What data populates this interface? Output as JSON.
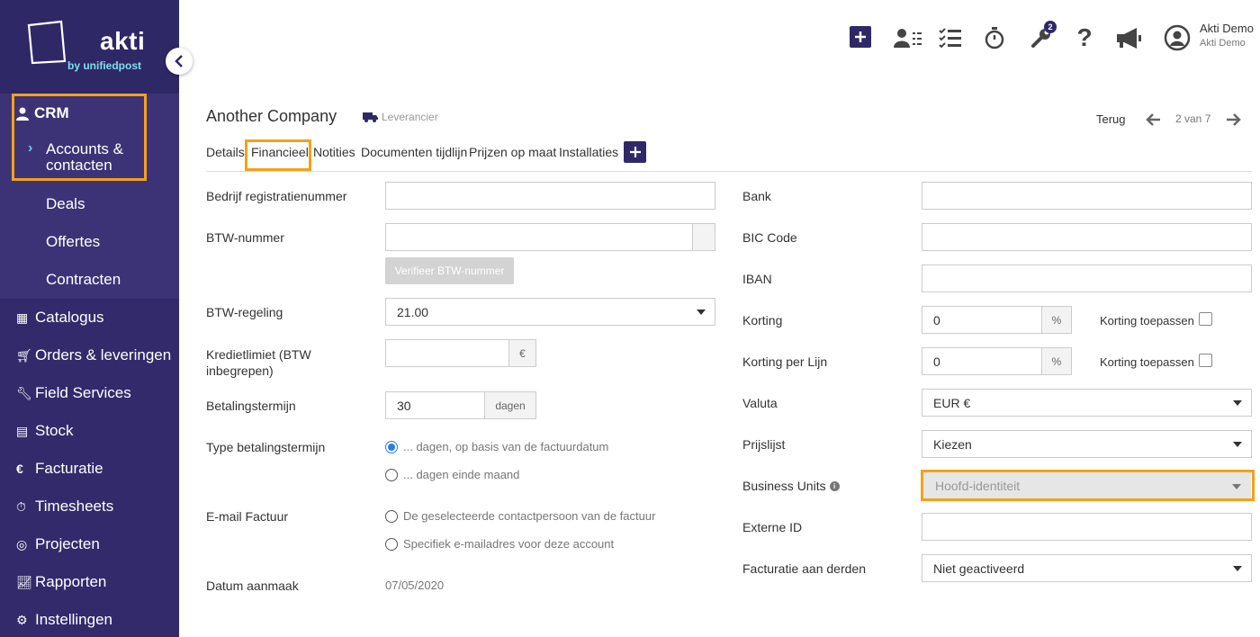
{
  "brand": {
    "name": "akti",
    "tagline": "by unifiedpost"
  },
  "sidebar": {
    "crm": "CRM",
    "crm_items": [
      "Accounts & contacten",
      "Deals",
      "Offertes",
      "Contracten"
    ],
    "main_items": [
      {
        "label": "Catalogus",
        "icon": "book-icon"
      },
      {
        "label": "Orders & leveringen",
        "icon": "cart-icon"
      },
      {
        "label": "Field Services",
        "icon": "wrench-icon"
      },
      {
        "label": "Stock",
        "icon": "boxes-icon"
      },
      {
        "label": "Facturatie",
        "icon": "euro-icon"
      },
      {
        "label": "Timesheets",
        "icon": "stopwatch-icon"
      },
      {
        "label": "Projecten",
        "icon": "target-icon"
      },
      {
        "label": "Rapporten",
        "icon": "chart-icon"
      },
      {
        "label": "Instellingen",
        "icon": "gear-icon"
      }
    ]
  },
  "topbar": {
    "badge_count": "2",
    "user_name": "Akti Demo",
    "user_company": "Akti Demo"
  },
  "header": {
    "title": "Another Company",
    "type_label": "Leverancier",
    "back": "Terug",
    "pager": "2 van 7"
  },
  "tabs": [
    "Details",
    "Financieel",
    "Notities",
    "Documenten tijdlijn",
    "Prijzen op maat",
    "Installaties"
  ],
  "left": {
    "reg_label": "Bedrijf registratienummer",
    "reg_value": "",
    "vat_label": "BTW-nummer",
    "vat_value": "",
    "verify_btn": "Verifieer BTW-nummer",
    "vat_regime_label": "BTW-regeling",
    "vat_regime_value": "21.00",
    "credit_label_1": "Kredietlimiet (BTW",
    "credit_label_2": "inbegrepen)",
    "credit_value": "",
    "credit_unit": "€",
    "term_label": "Betalingstermijn",
    "term_value": "30",
    "term_unit": "dagen",
    "term_type_label": "Type betalingstermijn",
    "term_type_options": [
      "... dagen, op basis van de factuurdatum",
      "... dagen einde maand"
    ],
    "email_label": "E-mail Factuur",
    "email_options": [
      "De geselecteerde contactpersoon van de factuur",
      "Specifiek e-mailadres voor deze account"
    ],
    "created_label": "Datum aanmaak",
    "created_value": "07/05/2020"
  },
  "right": {
    "bank_label": "Bank",
    "bic_label": "BIC Code",
    "iban_label": "IBAN",
    "discount_label": "Korting",
    "discount_value": "0",
    "discount_unit": "%",
    "apply_discount_label": "Korting toepassen",
    "line_discount_label": "Korting per Lijn",
    "line_discount_value": "0",
    "line_discount_unit": "%",
    "apply_line_discount_label": "Korting toepassen",
    "currency_label": "Valuta",
    "currency_value": "EUR €",
    "pricelist_label": "Prijslijst",
    "pricelist_value": "Kiezen",
    "bu_label": "Business Units",
    "bu_value": "Hoofd-identiteit",
    "external_label": "Externe ID",
    "external_value": "",
    "third_party_label": "Facturatie aan derden",
    "third_party_value": "Niet geactiveerd"
  },
  "colors": {
    "sidebar": "#332a6b",
    "accent": "#2f2867",
    "highlight": "#f4a11b",
    "radio": "#2a7de1"
  }
}
